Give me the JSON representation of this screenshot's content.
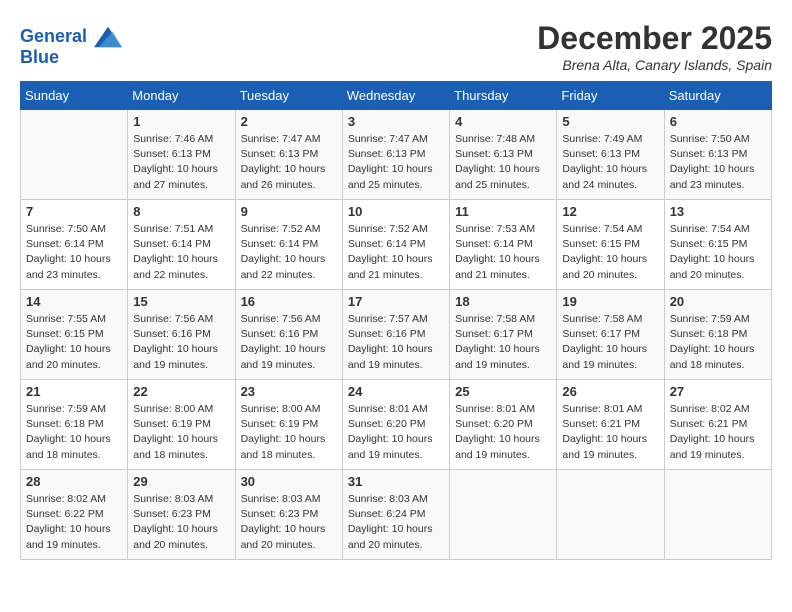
{
  "header": {
    "logo_line1": "General",
    "logo_line2": "Blue",
    "month": "December 2025",
    "location": "Brena Alta, Canary Islands, Spain"
  },
  "days_of_week": [
    "Sunday",
    "Monday",
    "Tuesday",
    "Wednesday",
    "Thursday",
    "Friday",
    "Saturday"
  ],
  "weeks": [
    [
      {
        "day": "",
        "info": ""
      },
      {
        "day": "1",
        "info": "Sunrise: 7:46 AM\nSunset: 6:13 PM\nDaylight: 10 hours\nand 27 minutes."
      },
      {
        "day": "2",
        "info": "Sunrise: 7:47 AM\nSunset: 6:13 PM\nDaylight: 10 hours\nand 26 minutes."
      },
      {
        "day": "3",
        "info": "Sunrise: 7:47 AM\nSunset: 6:13 PM\nDaylight: 10 hours\nand 25 minutes."
      },
      {
        "day": "4",
        "info": "Sunrise: 7:48 AM\nSunset: 6:13 PM\nDaylight: 10 hours\nand 25 minutes."
      },
      {
        "day": "5",
        "info": "Sunrise: 7:49 AM\nSunset: 6:13 PM\nDaylight: 10 hours\nand 24 minutes."
      },
      {
        "day": "6",
        "info": "Sunrise: 7:50 AM\nSunset: 6:13 PM\nDaylight: 10 hours\nand 23 minutes."
      }
    ],
    [
      {
        "day": "7",
        "info": "Sunrise: 7:50 AM\nSunset: 6:14 PM\nDaylight: 10 hours\nand 23 minutes."
      },
      {
        "day": "8",
        "info": "Sunrise: 7:51 AM\nSunset: 6:14 PM\nDaylight: 10 hours\nand 22 minutes."
      },
      {
        "day": "9",
        "info": "Sunrise: 7:52 AM\nSunset: 6:14 PM\nDaylight: 10 hours\nand 22 minutes."
      },
      {
        "day": "10",
        "info": "Sunrise: 7:52 AM\nSunset: 6:14 PM\nDaylight: 10 hours\nand 21 minutes."
      },
      {
        "day": "11",
        "info": "Sunrise: 7:53 AM\nSunset: 6:14 PM\nDaylight: 10 hours\nand 21 minutes."
      },
      {
        "day": "12",
        "info": "Sunrise: 7:54 AM\nSunset: 6:15 PM\nDaylight: 10 hours\nand 20 minutes."
      },
      {
        "day": "13",
        "info": "Sunrise: 7:54 AM\nSunset: 6:15 PM\nDaylight: 10 hours\nand 20 minutes."
      }
    ],
    [
      {
        "day": "14",
        "info": "Sunrise: 7:55 AM\nSunset: 6:15 PM\nDaylight: 10 hours\nand 20 minutes."
      },
      {
        "day": "15",
        "info": "Sunrise: 7:56 AM\nSunset: 6:16 PM\nDaylight: 10 hours\nand 19 minutes."
      },
      {
        "day": "16",
        "info": "Sunrise: 7:56 AM\nSunset: 6:16 PM\nDaylight: 10 hours\nand 19 minutes."
      },
      {
        "day": "17",
        "info": "Sunrise: 7:57 AM\nSunset: 6:16 PM\nDaylight: 10 hours\nand 19 minutes."
      },
      {
        "day": "18",
        "info": "Sunrise: 7:58 AM\nSunset: 6:17 PM\nDaylight: 10 hours\nand 19 minutes."
      },
      {
        "day": "19",
        "info": "Sunrise: 7:58 AM\nSunset: 6:17 PM\nDaylight: 10 hours\nand 19 minutes."
      },
      {
        "day": "20",
        "info": "Sunrise: 7:59 AM\nSunset: 6:18 PM\nDaylight: 10 hours\nand 18 minutes."
      }
    ],
    [
      {
        "day": "21",
        "info": "Sunrise: 7:59 AM\nSunset: 6:18 PM\nDaylight: 10 hours\nand 18 minutes."
      },
      {
        "day": "22",
        "info": "Sunrise: 8:00 AM\nSunset: 6:19 PM\nDaylight: 10 hours\nand 18 minutes."
      },
      {
        "day": "23",
        "info": "Sunrise: 8:00 AM\nSunset: 6:19 PM\nDaylight: 10 hours\nand 18 minutes."
      },
      {
        "day": "24",
        "info": "Sunrise: 8:01 AM\nSunset: 6:20 PM\nDaylight: 10 hours\nand 19 minutes."
      },
      {
        "day": "25",
        "info": "Sunrise: 8:01 AM\nSunset: 6:20 PM\nDaylight: 10 hours\nand 19 minutes."
      },
      {
        "day": "26",
        "info": "Sunrise: 8:01 AM\nSunset: 6:21 PM\nDaylight: 10 hours\nand 19 minutes."
      },
      {
        "day": "27",
        "info": "Sunrise: 8:02 AM\nSunset: 6:21 PM\nDaylight: 10 hours\nand 19 minutes."
      }
    ],
    [
      {
        "day": "28",
        "info": "Sunrise: 8:02 AM\nSunset: 6:22 PM\nDaylight: 10 hours\nand 19 minutes."
      },
      {
        "day": "29",
        "info": "Sunrise: 8:03 AM\nSunset: 6:23 PM\nDaylight: 10 hours\nand 20 minutes."
      },
      {
        "day": "30",
        "info": "Sunrise: 8:03 AM\nSunset: 6:23 PM\nDaylight: 10 hours\nand 20 minutes."
      },
      {
        "day": "31",
        "info": "Sunrise: 8:03 AM\nSunset: 6:24 PM\nDaylight: 10 hours\nand 20 minutes."
      },
      {
        "day": "",
        "info": ""
      },
      {
        "day": "",
        "info": ""
      },
      {
        "day": "",
        "info": ""
      }
    ]
  ]
}
